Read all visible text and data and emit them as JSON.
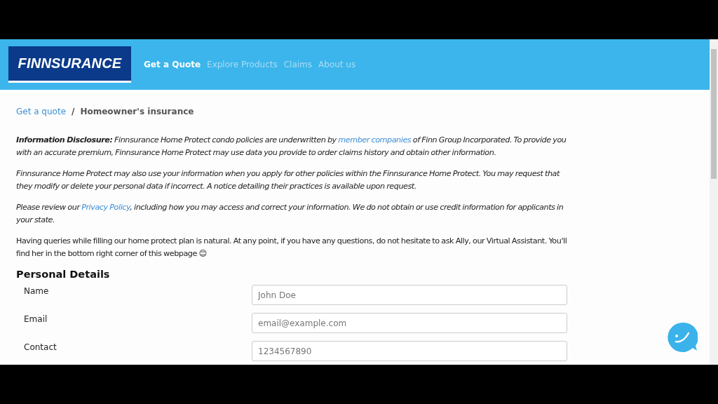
{
  "header": {
    "logo": "FINNSURANCE",
    "nav": [
      {
        "label": "Get a Quote",
        "selected": true
      },
      {
        "label": "Explore Products",
        "selected": false
      },
      {
        "label": "Claims",
        "selected": false
      },
      {
        "label": "About us",
        "selected": false
      }
    ]
  },
  "breadcrumb": {
    "link": "Get a quote",
    "separator": "/",
    "current": "Homeowner's insurance"
  },
  "paragraphs": [
    {
      "italic": true,
      "segments": [
        {
          "kind": "text",
          "text": "**Information Disclosure:** Finnsurance Home Protect condo policies are underwritten by "
        },
        {
          "kind": "link",
          "text": "member companies"
        },
        {
          "kind": "text",
          "text": " of Finn Group Incorporated. To provide you with an accurate premium, Finnsurance Home Protect may use data you provide to order claims history and obtain other information."
        }
      ]
    },
    {
      "italic": true,
      "segments": [
        {
          "kind": "text",
          "text": "Finnsurance Home Protect may also use your information when you apply for other policies within the Finnsurance Home Protect. You may request that they modify or delete your personal data if incorrect. A notice detailing their practices is available upon request."
        }
      ]
    },
    {
      "italic": true,
      "segments": [
        {
          "kind": "text",
          "text": "Please review our "
        },
        {
          "kind": "link",
          "text": "Privacy Policy"
        },
        {
          "kind": "text",
          "text": ", including how you may access and correct your information. We do not obtain or use credit information for applicants in your state."
        }
      ]
    },
    {
      "italic": false,
      "segments": [
        {
          "kind": "text",
          "text": "Having queries while filling our home protect plan is natural. At any point, if you have any questions, do not hesitate to ask Ally, our Virtual Assistant. You'll find her in the bottom right corner of this webpage 😊"
        }
      ]
    }
  ],
  "section": {
    "title": "Personal Details",
    "fields": [
      {
        "label": "Name",
        "placeholder": "John Doe"
      },
      {
        "label": "Email",
        "placeholder": "email@example.com"
      },
      {
        "label": "Contact",
        "placeholder": "1234567890"
      }
    ]
  }
}
